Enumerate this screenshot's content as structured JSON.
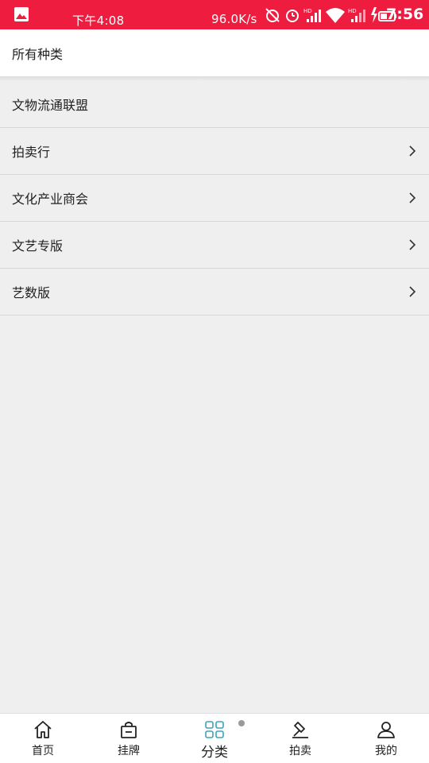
{
  "status_bar": {
    "time": "下午4:08",
    "net_speed": "96.0K/s",
    "clock": "7:56",
    "background": "#ee1c3f"
  },
  "header": {
    "title": "所有种类"
  },
  "categories": [
    {
      "label": "文物流通联盟",
      "has_arrow": false
    },
    {
      "label": "拍卖行",
      "has_arrow": true
    },
    {
      "label": "文化产业商会",
      "has_arrow": true
    },
    {
      "label": "文艺专版",
      "has_arrow": true
    },
    {
      "label": "艺数版",
      "has_arrow": true
    }
  ],
  "tabbar": {
    "active": "分类",
    "tabs": [
      {
        "label": "首页",
        "icon": "home-icon"
      },
      {
        "label": "挂牌",
        "icon": "bag-icon"
      },
      {
        "label": "分类",
        "icon": "grid-icon"
      },
      {
        "label": "拍卖",
        "icon": "gavel-icon"
      },
      {
        "label": "我的",
        "icon": "user-icon"
      }
    ],
    "active_color": "#3ca3b9"
  }
}
